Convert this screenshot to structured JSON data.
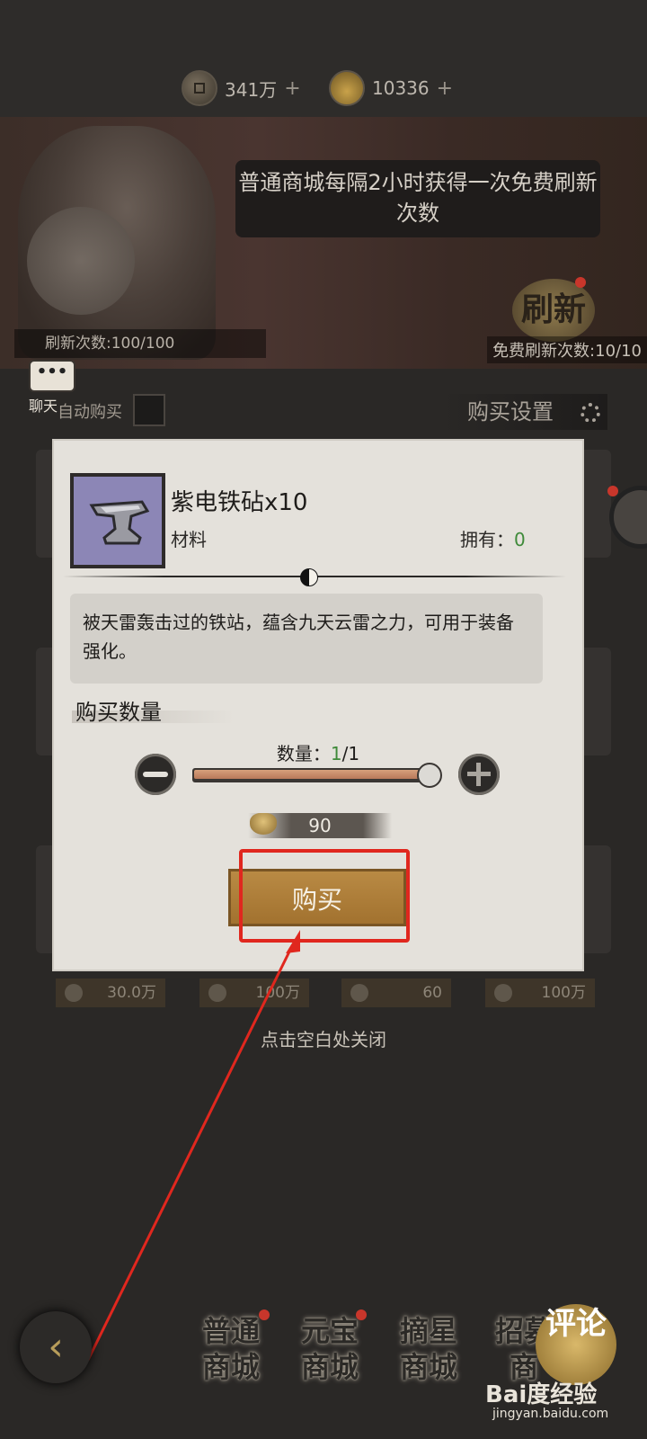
{
  "resources": {
    "coins": "341万",
    "ingots": "10336",
    "plus": "+"
  },
  "banner": {
    "notice": "普通商城每隔2小时获得一次免费刷新次数",
    "refresh_count": "刷新次数:100/100",
    "refresh_button": "刷新",
    "free_refresh": "免费刷新次数:10/10"
  },
  "chat": {
    "bubble": "•••",
    "label": "聊天"
  },
  "shop": {
    "auto_buy": "自动购买",
    "buy_settings": "购买设置",
    "prices": [
      "30.0万",
      "100万",
      "60",
      "100万"
    ],
    "close_hint": "点击空白处关闭"
  },
  "modal": {
    "item_name": "紫电铁砧x10",
    "item_type": "材料",
    "owned_label": "拥有：",
    "owned_value": "0",
    "description": "被天雷轰击过的铁站，蕴含九天云雷之力，可用于装备强化。",
    "quantity_title": "购买数量",
    "quantity_label": "数量：",
    "quantity_current": "1",
    "quantity_total": "/1",
    "quantity_fraction": 1.0,
    "cost": "90",
    "buy_button": "购买"
  },
  "bottom_nav": {
    "back": "‹",
    "items": [
      "普通商城",
      "元宝商城",
      "摘星商城",
      "招募商"
    ],
    "comment": "评论",
    "watermark": "Bai度经验",
    "watermark_sub": "jingyan.baidu.com"
  },
  "colors": {
    "accent_red": "#e0271e",
    "buy_button": "#b98a44",
    "owned_green": "#3f8a3a"
  }
}
